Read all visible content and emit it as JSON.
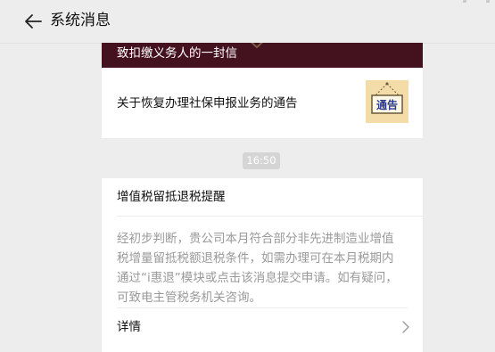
{
  "header": {
    "title": "系统消息",
    "back_icon": "arrow-left-icon"
  },
  "notice_card": {
    "banner_text": "致扣缴义务人的一封信",
    "banner_color": "#44121f",
    "notice_title": "关于恢复办理社保申报业务的通告",
    "thumbnail_text": "通告"
  },
  "timestamp": "16:50",
  "message_card": {
    "title": "增值税留抵退税提醒",
    "body": "经初步判断，贵公司本月符合部分非先进制造业增值税增量留抵税额退税条件，如需办理可在本月税期内通过“i惠退”模块或点击该消息提交申请。如有疑问，可致电主管税务机关咨询。",
    "detail_label": "详情",
    "detail_icon": "chevron-right-icon"
  }
}
